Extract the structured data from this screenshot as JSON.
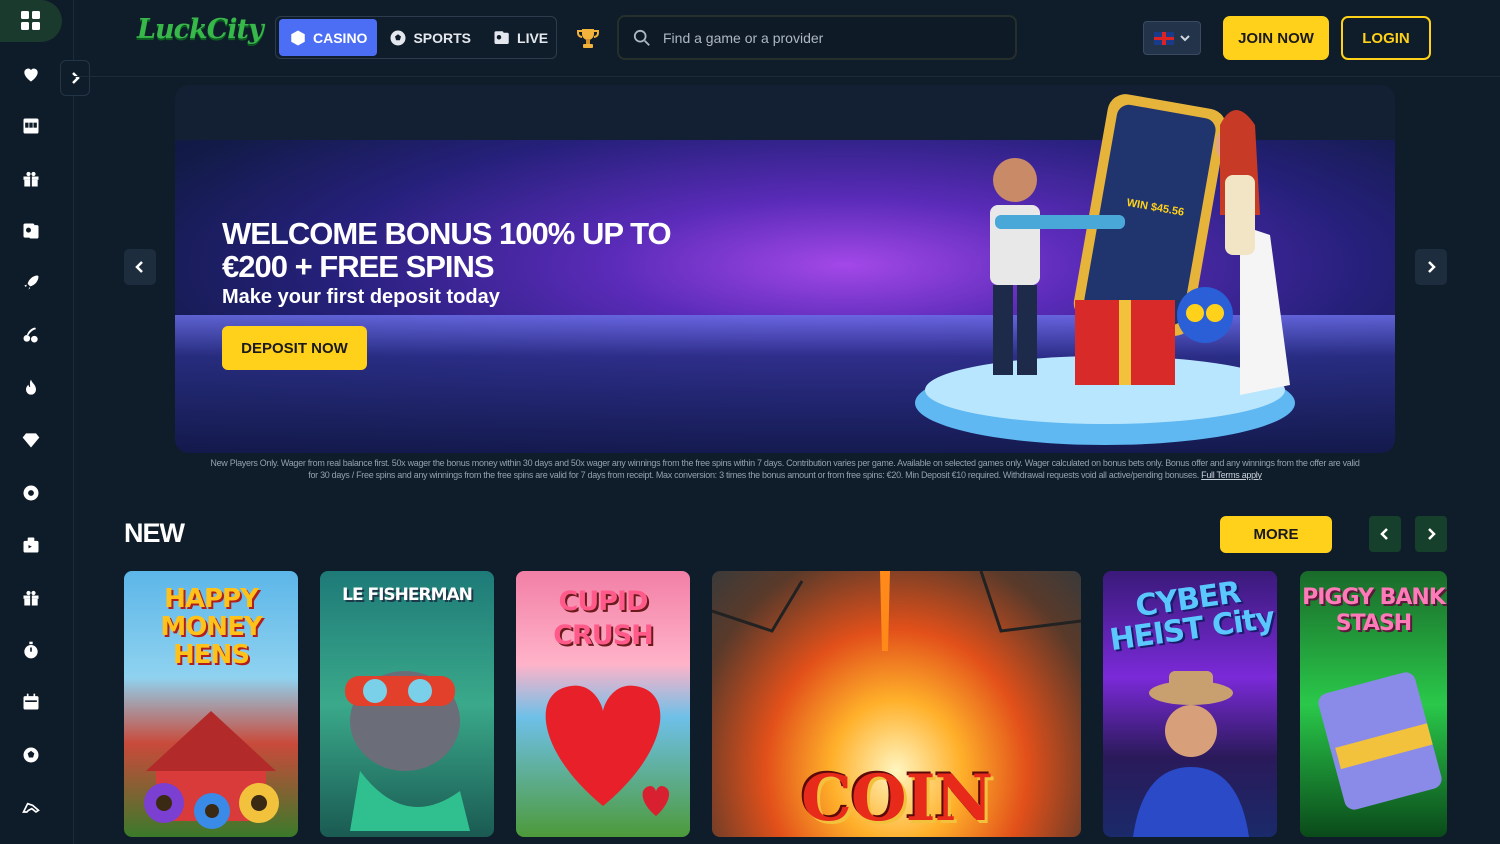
{
  "header": {
    "logo_text": "LuckCity",
    "nav_tabs": [
      {
        "label": "CASINO",
        "icon": "cube-icon",
        "active": true
      },
      {
        "label": "SPORTS",
        "icon": "soccer-ball-icon",
        "active": false
      },
      {
        "label": "LIVE",
        "icon": "cards-icon",
        "active": false
      }
    ],
    "search_placeholder": "Find a game or a provider",
    "language": "EN",
    "join_label": "JOIN NOW",
    "login_label": "LOGIN"
  },
  "sidebar": {
    "icons": [
      "grid-icon",
      "heart-icon",
      "slot-machine-icon",
      "gift-icon",
      "live-cards-icon",
      "rocket-icon",
      "cherries-icon",
      "fire-icon",
      "diamond-icon",
      "sports-ball-icon",
      "bag-icon",
      "gift-box-icon",
      "stopwatch-icon",
      "calendar-icon",
      "football-icon",
      "racing-icon"
    ]
  },
  "banner": {
    "title": "WELCOME BONUS 100% UP TO €200 + FREE SPINS",
    "subtitle": "Make your first deposit today",
    "cta": "DEPOSIT NOW",
    "terms": "New Players Only. Wager from real balance first. 50x wager the bonus money within 30 days and 50x wager any winnings from the free spins within 7 days. Contribution varies per game. Available on selected games only. Wager calculated on bonus bets only. Bonus offer and any winnings from the offer are valid for 30 days / Free spins and any winnings from the free spins are valid for 7 days from receipt. Max conversion: 3 times the bonus amount or from free spins: €20. Min Deposit €10 required. Withdrawal requests void all active/pending bonuses.",
    "terms_link": "Full Terms apply",
    "win_label": "WIN $45.56"
  },
  "new_section": {
    "title": "NEW",
    "more_label": "MORE",
    "games": [
      {
        "name": "HAPPY MONEY HENS"
      },
      {
        "name": "LE FISHERMAN"
      },
      {
        "name": "CUPID CRUSH"
      },
      {
        "name": "COIN"
      },
      {
        "name": "CYBER HEIST City"
      },
      {
        "name": "PIGGY BANK STASH"
      }
    ]
  }
}
